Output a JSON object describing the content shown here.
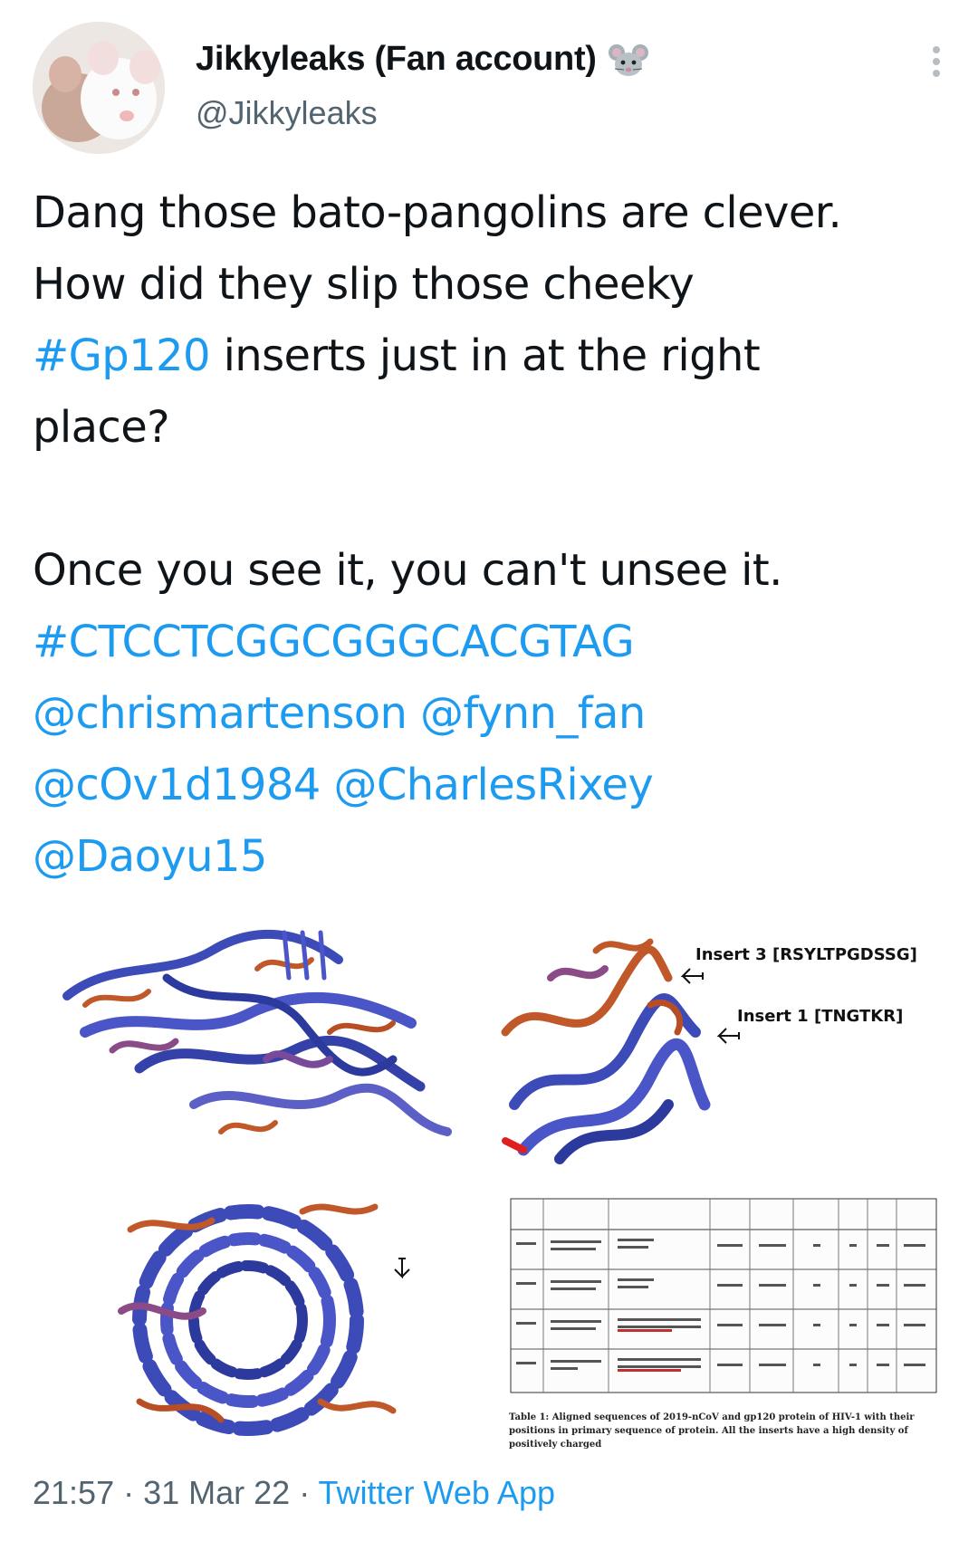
{
  "author": {
    "display_name": "Jikkyleaks (Fan account)",
    "handle": "@Jikkyleaks",
    "name_emoji": "mouse-face-icon",
    "avatar": "two-white-mice-photo"
  },
  "tweet": {
    "line1": "Dang those bato-pangolins are clever.",
    "line2": "How did they slip those cheeky",
    "line3_hashtag": "#Gp120",
    "line3_rest": " inserts just in at the right",
    "line4": "place?",
    "line5": "Once you see it, you can't unsee it.",
    "hashtag2": "#CTCCTCGGCGGGCACGTAG",
    "mention1": "@chrismartenson",
    "mention2": "@fynn_fan",
    "mention3": "@cOv1d1984",
    "mention4": "@CharlesRixey",
    "mention5": "@Daoyu15"
  },
  "media": {
    "image2_label1": "Insert 3 [RSYLTPGDSSG]",
    "image2_label2": "Insert 1 [TNGTKR]",
    "table_caption": "Table 1: Aligned sequences of 2019-nCoV and gp120 protein of HIV-1 with their positions in primary sequence of protein. All the inserts have a high density of positively charged"
  },
  "meta": {
    "time": "21:57",
    "separator": " · ",
    "date": "31 Mar 22",
    "app": "Twitter Web App"
  },
  "colors": {
    "link": "#1d9bf0",
    "secondary_text": "#536471",
    "primary_text": "#0f1419"
  }
}
